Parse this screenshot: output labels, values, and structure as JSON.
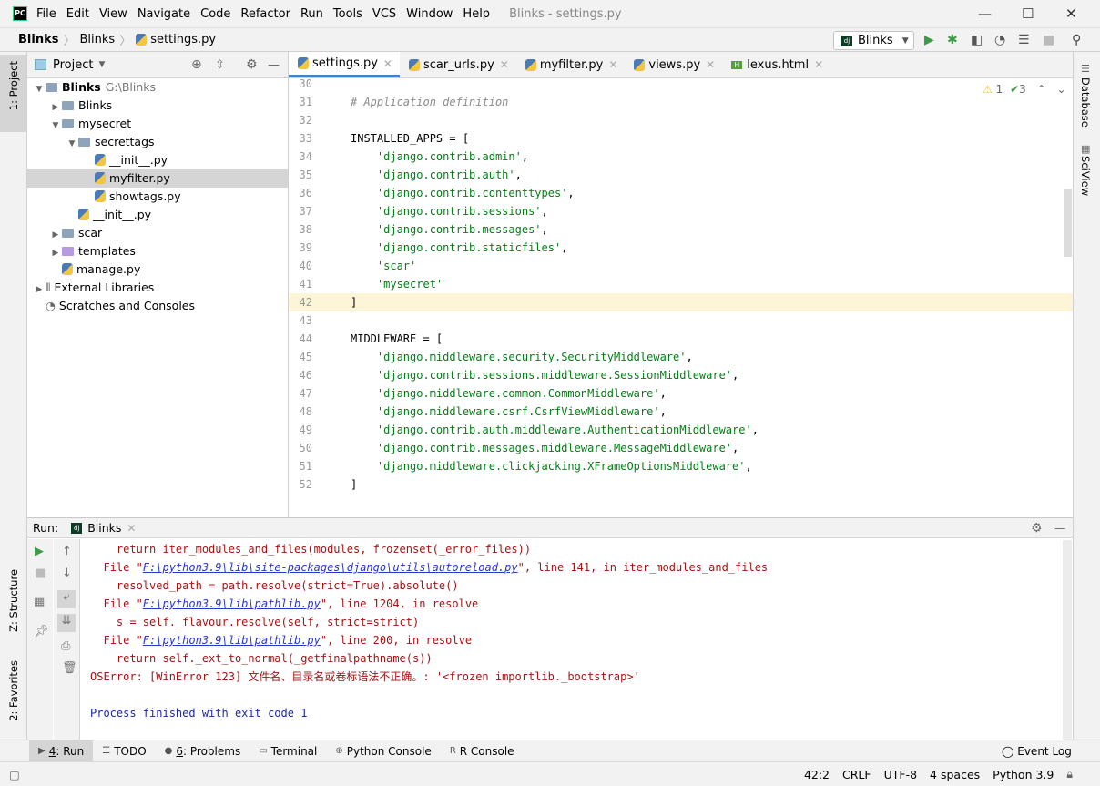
{
  "menubar": {
    "items": [
      "File",
      "Edit",
      "View",
      "Navigate",
      "Code",
      "Refactor",
      "Run",
      "Tools",
      "VCS",
      "Window",
      "Help"
    ],
    "window_title": "Blinks - settings.py"
  },
  "breadcrumb": [
    "Blinks",
    "Blinks",
    "settings.py"
  ],
  "run_config": "Blinks",
  "project": {
    "title": "Project",
    "tree": [
      {
        "label": "Blinks",
        "hint": "G:\\Blinks",
        "depth": 0,
        "type": "folder",
        "expanded": true,
        "bold": true
      },
      {
        "label": "Blinks",
        "depth": 1,
        "type": "folder",
        "expanded": false
      },
      {
        "label": "mysecret",
        "depth": 1,
        "type": "folder",
        "expanded": true
      },
      {
        "label": "secrettags",
        "depth": 2,
        "type": "folder",
        "expanded": true
      },
      {
        "label": "__init__.py",
        "depth": 3,
        "type": "py"
      },
      {
        "label": "myfilter.py",
        "depth": 3,
        "type": "py",
        "selected": true
      },
      {
        "label": "showtags.py",
        "depth": 3,
        "type": "py"
      },
      {
        "label": "__init__.py",
        "depth": 2,
        "type": "py"
      },
      {
        "label": "scar",
        "depth": 1,
        "type": "folder",
        "expanded": false
      },
      {
        "label": "templates",
        "depth": 1,
        "type": "folder-purple",
        "expanded": false
      },
      {
        "label": "manage.py",
        "depth": 1,
        "type": "py"
      },
      {
        "label": "External Libraries",
        "depth": 0,
        "type": "lib",
        "expanded": false
      },
      {
        "label": "Scratches and Consoles",
        "depth": 0,
        "type": "scratch"
      }
    ]
  },
  "editor": {
    "tabs": [
      {
        "label": "settings.py",
        "active": true
      },
      {
        "label": "scar_urls.py"
      },
      {
        "label": "myfilter.py"
      },
      {
        "label": "views.py"
      },
      {
        "label": "lexus.html"
      }
    ],
    "warnings": "1",
    "typos": "3",
    "lines": [
      {
        "n": "30",
        "t": "",
        "k": "kw"
      },
      {
        "n": "31",
        "t": "# Application definition",
        "k": "cm"
      },
      {
        "n": "32",
        "t": "",
        "k": "kw"
      },
      {
        "n": "33",
        "t": "INSTALLED_APPS = [",
        "k": "kw"
      },
      {
        "n": "34",
        "t": "    'django.contrib.admin',",
        "k": "st"
      },
      {
        "n": "35",
        "t": "    'django.contrib.auth',",
        "k": "st"
      },
      {
        "n": "36",
        "t": "    'django.contrib.contenttypes',",
        "k": "st"
      },
      {
        "n": "37",
        "t": "    'django.contrib.sessions',",
        "k": "st"
      },
      {
        "n": "38",
        "t": "    'django.contrib.messages',",
        "k": "st"
      },
      {
        "n": "39",
        "t": "    'django.contrib.staticfiles',",
        "k": "st"
      },
      {
        "n": "40",
        "t": "    'scar'",
        "k": "st"
      },
      {
        "n": "41",
        "t": "    'mysecret'",
        "k": "st"
      },
      {
        "n": "42",
        "t": "]",
        "k": "kw",
        "current": true
      },
      {
        "n": "43",
        "t": "",
        "k": "kw"
      },
      {
        "n": "44",
        "t": "MIDDLEWARE = [",
        "k": "kw"
      },
      {
        "n": "45",
        "t": "    'django.middleware.security.SecurityMiddleware',",
        "k": "st"
      },
      {
        "n": "46",
        "t": "    'django.contrib.sessions.middleware.SessionMiddleware',",
        "k": "st"
      },
      {
        "n": "47",
        "t": "    'django.middleware.common.CommonMiddleware',",
        "k": "st"
      },
      {
        "n": "48",
        "t": "    'django.middleware.csrf.CsrfViewMiddleware',",
        "k": "st"
      },
      {
        "n": "49",
        "t": "    'django.contrib.auth.middleware.AuthenticationMiddleware',",
        "k": "st"
      },
      {
        "n": "50",
        "t": "    'django.contrib.messages.middleware.MessageMiddleware',",
        "k": "st"
      },
      {
        "n": "51",
        "t": "    'django.middleware.clickjacking.XFrameOptionsMiddleware',",
        "k": "st"
      },
      {
        "n": "52",
        "t": "]",
        "k": "kw"
      }
    ]
  },
  "run": {
    "label": "Run:",
    "tab": "Blinks",
    "output": [
      {
        "pre": "    return iter_modules_and_files(modules, frozenset(_error_files))"
      },
      {
        "pre": "  File \"",
        "link": "F:\\python3.9\\lib\\site-packages\\django\\utils\\autoreload.py",
        "post": "\", line 141, in iter_modules_and_files"
      },
      {
        "pre": "    resolved_path = path.resolve(strict=True).absolute()"
      },
      {
        "pre": "  File \"",
        "link": "F:\\python3.9\\lib\\pathlib.py",
        "post": "\", line 1204, in resolve"
      },
      {
        "pre": "    s = self._flavour.resolve(self, strict=strict)"
      },
      {
        "pre": "  File \"",
        "link": "F:\\python3.9\\lib\\pathlib.py",
        "post": "\", line 200, in resolve"
      },
      {
        "pre": "    return self._ext_to_normal(_getfinalpathname(s))"
      },
      {
        "pre": "OSError: [WinError 123] 文件名、目录名或卷标语法不正确。: '<frozen importlib._bootstrap>'"
      },
      {
        "pre": ""
      },
      {
        "pre": "Process finished with exit code 1",
        "blue": true
      }
    ]
  },
  "left_strip": {
    "project": "1: Project",
    "structure": "Z: Structure",
    "favorites": "2: Favorites"
  },
  "right_strip": {
    "database": "Database",
    "sciview": "SciView"
  },
  "bottom_tabs": [
    {
      "num": "4",
      "label": ": Run",
      "active": true
    },
    {
      "label": "TODO"
    },
    {
      "num": "6",
      "label": ": Problems"
    },
    {
      "label": "Terminal"
    },
    {
      "label": "Python Console"
    },
    {
      "label": "R Console"
    }
  ],
  "event_log": "Event Log",
  "status": {
    "position": "42:2",
    "line_sep": "CRLF",
    "encoding": "UTF-8",
    "indent": "4 spaces",
    "interpreter": "Python 3.9"
  },
  "colors": {
    "accent": "#4083c9",
    "string": "#067d17",
    "error": "#a31515",
    "link": "#2a36c9",
    "current_line": "#fcf5d7"
  }
}
